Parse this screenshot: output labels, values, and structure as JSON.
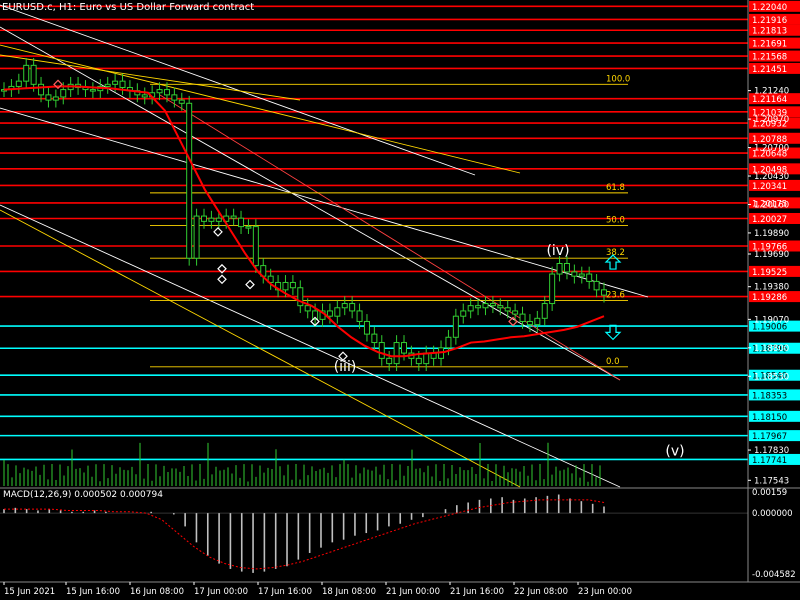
{
  "window": {
    "title": "EURUSD.c, H1:  Euro vs US Dollar Forward contract"
  },
  "colors": {
    "background": "#000000",
    "candle": "#32cd32",
    "text": "#ffffff",
    "red_level": "#ff0000",
    "cyan_level": "#00ffff",
    "fib": "#ffd700",
    "channel": "#ffffff",
    "ma": "#ff0000"
  },
  "chart_data": {
    "type": "candlestick",
    "symbol": "EURUSD.c",
    "timeframe": "H1",
    "ylim": [
      1.1747,
      1.221
    ],
    "x_tick_labels": [
      "15 Jun 2021",
      "15 Jun 16:00",
      "16 Jun 08:00",
      "17 Jun 00:00",
      "17 Jun 16:00",
      "18 Jun 08:00",
      "21 Jun 00:00",
      "21 Jun 16:00",
      "22 Jun 08:00",
      "23 Jun 00:00"
    ],
    "y_tick_labels": [
      "1.21240",
      "1.20970",
      "1.20700",
      "1.20430",
      "1.20160",
      "1.19890",
      "1.19690",
      "1.19380",
      "1.19070",
      "1.18800",
      "1.18530",
      "1.17830",
      "1.17543"
    ],
    "price_levels": [
      {
        "value": "1.22040",
        "color": "red"
      },
      {
        "value": "1.21916",
        "color": "red"
      },
      {
        "value": "1.21813",
        "color": "red"
      },
      {
        "value": "1.21691",
        "color": "red"
      },
      {
        "value": "1.21568",
        "color": "red"
      },
      {
        "value": "1.21451",
        "color": "red"
      },
      {
        "value": "1.21164",
        "color": "red"
      },
      {
        "value": "1.21039",
        "color": "red"
      },
      {
        "value": "1.20932",
        "color": "red"
      },
      {
        "value": "1.20788",
        "color": "red"
      },
      {
        "value": "1.20648",
        "color": "red"
      },
      {
        "value": "1.20498",
        "color": "red"
      },
      {
        "value": "1.20341",
        "color": "red"
      },
      {
        "value": "1.20175",
        "color": "red"
      },
      {
        "value": "1.20027",
        "color": "red"
      },
      {
        "value": "1.19766",
        "color": "red"
      },
      {
        "value": "1.19525",
        "color": "red"
      },
      {
        "value": "1.19286",
        "color": "red"
      },
      {
        "value": "1.19006",
        "color": "cyan"
      },
      {
        "value": "1.18796",
        "color": "cyan"
      },
      {
        "value": "1.18540",
        "color": "cyan"
      },
      {
        "value": "1.18353",
        "color": "cyan"
      },
      {
        "value": "1.18150",
        "color": "cyan"
      },
      {
        "value": "1.17967",
        "color": "cyan"
      },
      {
        "value": "1.17741",
        "color": "cyan"
      }
    ],
    "fib_levels": [
      {
        "label": "100.0",
        "value": 1.213
      },
      {
        "label": "61.8",
        "value": 1.2027
      },
      {
        "label": "50.0",
        "value": 1.1996
      },
      {
        "label": "38.2",
        "value": 1.1965
      },
      {
        "label": "23.6",
        "value": 1.1925
      },
      {
        "label": "0.0",
        "value": 1.1862
      }
    ],
    "wave_labels": [
      {
        "label": "(iii)",
        "at": 1.1858
      },
      {
        "label": "(iv)",
        "at": 1.1968
      },
      {
        "label": "(v)",
        "at": 1.1778
      }
    ],
    "close_series": [
      1.2125,
      1.2128,
      1.2133,
      1.2148,
      1.213,
      1.212,
      1.2115,
      1.2118,
      1.2125,
      1.213,
      1.2127,
      1.2125,
      1.2124,
      1.2128,
      1.213,
      1.2133,
      1.2127,
      1.2124,
      1.212,
      1.2118,
      1.2122,
      1.2125,
      1.212,
      1.2115,
      1.2112,
      1.1965,
      1.2005,
      1.2,
      1.2003,
      1.2,
      1.2005,
      1.2003,
      1.1995,
      1.1995,
      1.1958,
      1.1948,
      1.1942,
      1.1935,
      1.1942,
      1.1937,
      1.192,
      1.1915,
      1.1907,
      1.1915,
      1.191,
      1.1918,
      1.1922,
      1.1915,
      1.1905,
      1.1893,
      1.1885,
      1.187,
      1.1865,
      1.1885,
      1.1875,
      1.187,
      1.1865,
      1.1875,
      1.187,
      1.188,
      1.189,
      1.191,
      1.1915,
      1.192,
      1.1918,
      1.1922,
      1.192,
      1.1918,
      1.1915,
      1.1912,
      1.1905,
      1.1902,
      1.1908,
      1.1922,
      1.195,
      1.196,
      1.1952,
      1.1948,
      1.195,
      1.1943,
      1.1935,
      1.193
    ],
    "moving_average": [
      1.2125,
      1.2126,
      1.2127,
      1.2128,
      1.2128,
      1.2127,
      1.2126,
      1.2124,
      1.2122,
      1.2105,
      1.208,
      1.2055,
      1.203,
      1.201,
      1.199,
      1.197,
      1.1952,
      1.194,
      1.1932,
      1.1925,
      1.192,
      1.1912,
      1.19,
      1.189,
      1.1882,
      1.1876,
      1.1872,
      1.1872,
      1.1874,
      1.1875,
      1.1876,
      1.188,
      1.1885,
      1.1886,
      1.1888,
      1.189,
      1.1891,
      1.1893,
      1.1895,
      1.1897,
      1.19,
      1.1905,
      1.191
    ],
    "macd": {
      "label": "MACD(12,26,9) 0.000502 0.000794",
      "y_tick_labels": [
        "0.00159",
        "0.000000",
        "-0.004582"
      ],
      "ylim": [
        -0.004582,
        0.00159
      ],
      "histogram": [
        0.0003,
        0.0004,
        0.0003,
        0.0002,
        0.0003,
        0.0002,
        0.0001,
        0.0001,
        0.0002,
        0.0001,
        0.0,
        0.0,
        0.0,
        0.0001,
        0.0,
        -0.0001,
        -0.001,
        -0.0022,
        -0.0032,
        -0.0038,
        -0.0042,
        -0.0044,
        -0.0045,
        -0.0044,
        -0.0042,
        -0.004,
        -0.0035,
        -0.003,
        -0.0026,
        -0.0022,
        -0.002,
        -0.0017,
        -0.0015,
        -0.0013,
        -0.001,
        -0.0008,
        -0.0005,
        -0.0003,
        0.0,
        0.0003,
        0.0006,
        0.0008,
        0.001,
        0.0011,
        0.0012,
        0.001,
        0.0011,
        0.0012,
        0.0013,
        0.0014,
        0.0011,
        0.0009,
        0.0007,
        0.0005
      ],
      "signal": [
        0.0003,
        0.0003,
        0.0003,
        0.0003,
        0.0002,
        0.0002,
        0.0002,
        0.0001,
        0.0001,
        0.0,
        -0.0005,
        -0.0015,
        -0.0025,
        -0.0033,
        -0.0038,
        -0.0041,
        -0.0042,
        -0.0041,
        -0.0039,
        -0.0036,
        -0.0032,
        -0.0028,
        -0.0024,
        -0.002,
        -0.0016,
        -0.0012,
        -0.0008,
        -0.0005,
        -0.0002,
        0.0001,
        0.0004,
        0.0006,
        0.0008,
        0.0009,
        0.001,
        0.001,
        0.001,
        0.001,
        0.0008
      ]
    },
    "grid": false,
    "legend": "none"
  }
}
